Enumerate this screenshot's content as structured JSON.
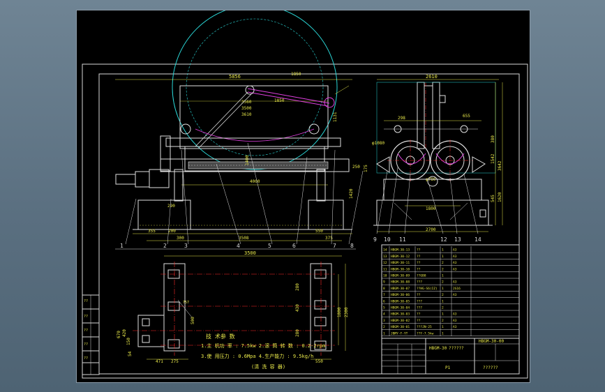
{
  "app": {
    "background_color": "#6f8494",
    "viewport_color": "#000000"
  },
  "colors": {
    "frame": "#d8d8d8",
    "border_green": "#1fd08a",
    "outline_cyan": "#2ad6d6",
    "dim_yellow": "#e8e84a",
    "center_red": "#ff2a2a",
    "hatch_magenta": "#e040e0",
    "part_white": "#e0e0e0"
  },
  "front_view": {
    "dims": {
      "overall_top": "5856",
      "inner_1": "3560",
      "inner_2": "3500",
      "inner_3": "3610",
      "arm": "1850",
      "arm_2": "1850",
      "height_right": "1131",
      "vertical_1": "1400",
      "length": "4000",
      "height_left": "1420",
      "bot_1": "355",
      "bot_2": "200",
      "bot_3": "300",
      "bot_4": "3508",
      "bot_5": "550",
      "bot_6": "375",
      "bot_7": "250",
      "left_small": "290",
      "left_small_2": "210",
      "diam": "120",
      "radius": "R"
    },
    "callouts": [
      "1",
      "2",
      "3",
      "4",
      "5",
      "6",
      "7",
      "8"
    ]
  },
  "side_view": {
    "dims": {
      "width_top": "2610",
      "d_298": "298",
      "d_655": "655",
      "h_380": "380",
      "h_1542": "1542",
      "h_3642": "3642",
      "h_545": "545",
      "h_1620": "1620",
      "d_1800": "1800",
      "d_2700": "2700",
      "phi_1": "φ1080",
      "phi_2": "φ780",
      "d_175": "175"
    },
    "callouts": [
      "9",
      "10",
      "11",
      "12",
      "13",
      "14"
    ]
  },
  "plan_view": {
    "dims": {
      "width_top": "3500",
      "d_280": "280",
      "d_430": "430",
      "h_1800": "1800",
      "h_2300": "2300",
      "d_280b": "280",
      "d_500": "500",
      "d_350": "350",
      "d_670": "670",
      "d_420": "420",
      "d_150": "150",
      "d_54": "54",
      "d_471": "471",
      "d_275": "275",
      "d_550": "550",
      "d_757": "757"
    }
  },
  "tech_notes": {
    "title": "技 术参 数",
    "line1": "1.主 机功 率 : 7.5kw   2.滚 筒 转 数 : 0.2-2rpm",
    "line2": "3.使 用压力 : 0.6Mpa  4.生产能力 : 9.5kg/h",
    "footer": "(清 洗 容 器)"
  },
  "bom": {
    "rows": [
      [
        "14",
        "HBGM-30-13",
        "??",
        "1",
        "A3",
        ""
      ],
      [
        "13",
        "HBGM-30-12",
        "??",
        "1",
        "A3",
        ""
      ],
      [
        "12",
        "HBGM-30-11",
        "??",
        "2",
        "A3",
        ""
      ],
      [
        "11",
        "HBGM-30-10",
        "??",
        "2",
        "A3",
        ""
      ],
      [
        "10",
        "HBGM-30-09",
        "??GB8",
        "1",
        "",
        ""
      ],
      [
        "9",
        "HBGM-30-08",
        "???",
        "2",
        "A3",
        ""
      ],
      [
        "8",
        "HBGM-30-07",
        "??HG-S6(IZ)",
        "1",
        "2G16",
        ""
      ],
      [
        "7",
        "HBGM-30-06",
        "??",
        "2",
        "A3",
        ""
      ],
      [
        "6",
        "HBGM-30-05",
        "???",
        "1",
        "",
        ""
      ],
      [
        "5",
        "HBGM-30-04",
        "???",
        "2",
        "",
        ""
      ],
      [
        "4",
        "HBGM-30-03",
        "??",
        "1",
        "A3",
        ""
      ],
      [
        "3",
        "HBGM-30-02",
        "??",
        "2",
        "A3",
        ""
      ],
      [
        "2",
        "HBGM-30-01",
        "???JN-25",
        "1",
        "A3",
        ""
      ],
      [
        "1",
        "JBMY-F-YT",
        "??Y-7.5kw",
        "1",
        "",
        ""
      ]
    ],
    "title_block": {
      "drawing_name": "HBGM-30",
      "drawing_no": "HBGM-30-00",
      "subtitle": "??????",
      "designer": "??????",
      "sheet": "P1"
    },
    "left_stamp": [
      "??",
      "??",
      "??",
      "??",
      "??"
    ]
  },
  "chart_data": null
}
